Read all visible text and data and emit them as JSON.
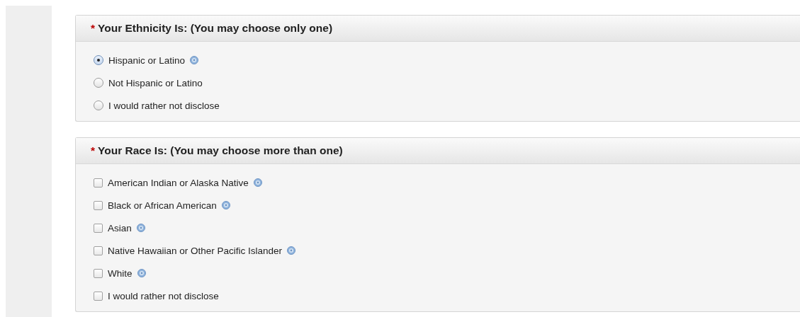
{
  "sections": [
    {
      "required_mark": "*",
      "title": "Your Ethnicity Is: (You may choose only one)",
      "kind": "radio",
      "options": [
        {
          "label": "Hispanic or Latino",
          "selected": true,
          "help": true
        },
        {
          "label": "Not Hispanic or Latino",
          "selected": false,
          "help": false
        },
        {
          "label": "I would rather not disclose",
          "selected": false,
          "help": false
        }
      ]
    },
    {
      "required_mark": "*",
      "title": "Your Race Is: (You may choose more than one)",
      "kind": "checkbox",
      "options": [
        {
          "label": "American Indian or Alaska Native",
          "checked": false,
          "help": true
        },
        {
          "label": "Black or African American",
          "checked": false,
          "help": true
        },
        {
          "label": "Asian",
          "checked": false,
          "help": true
        },
        {
          "label": "Native Hawaiian or Other Pacific Islander",
          "checked": false,
          "help": true
        },
        {
          "label": "White",
          "checked": false,
          "help": true
        },
        {
          "label": "I would rather not disclose",
          "checked": false,
          "help": false
        }
      ]
    }
  ]
}
